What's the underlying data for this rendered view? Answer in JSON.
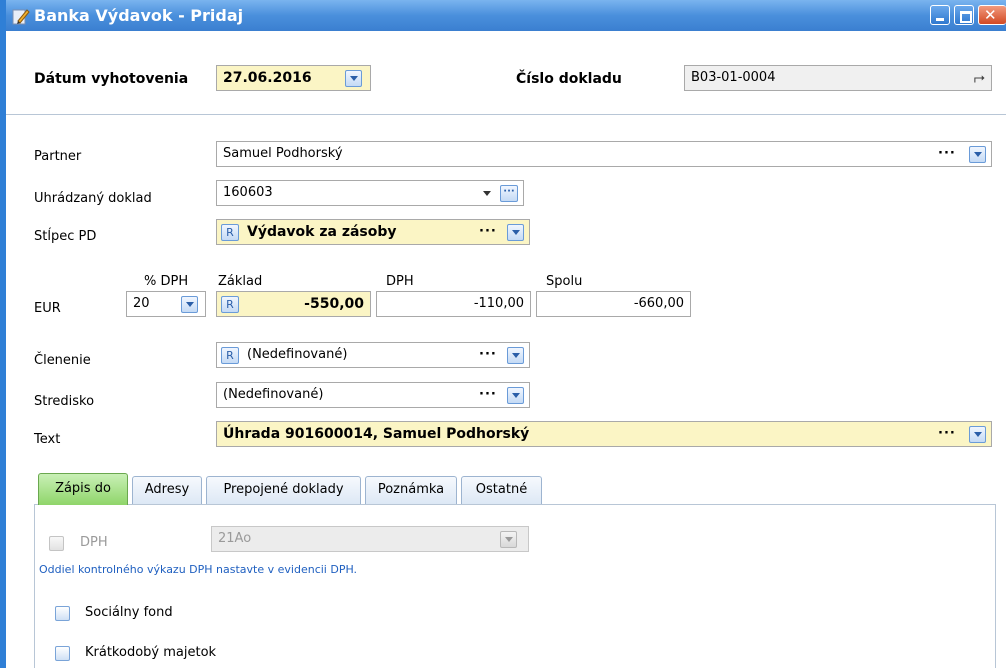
{
  "window": {
    "title": "Banka Výdavok - Pridaj"
  },
  "header": {
    "date_label": "Dátum vyhotovenia",
    "date_value": "27.06.2016",
    "doc_number_label": "Číslo dokladu",
    "doc_number_value": "B03-01-0004"
  },
  "form": {
    "partner_label": "Partner",
    "partner_value": "Samuel Podhorský",
    "paid_doc_label": "Uhrádzaný doklad",
    "paid_doc_value": "160603",
    "column_label": "Stĺpec PD",
    "column_value": "Výdavok za zásoby",
    "currency_label": "EUR",
    "vat_pct_header": "% DPH",
    "vat_pct_value": "20",
    "base_header": "Základ",
    "base_value": "-550,00",
    "vat_header": "DPH",
    "vat_value": "-110,00",
    "total_header": "Spolu",
    "total_value": "-660,00",
    "breakdown_label": "Členenie",
    "breakdown_value": "(Nedefinované)",
    "center_label": "Stredisko",
    "center_value": "(Nedefinované)",
    "text_label": "Text",
    "text_value": "Úhrada 901600014, Samuel Podhorský",
    "r_badge": "R",
    "dots": "···"
  },
  "tabs": [
    {
      "label": "Zápis do",
      "active": true
    },
    {
      "label": "Adresy",
      "active": false
    },
    {
      "label": "Prepojené doklady",
      "active": false
    },
    {
      "label": "Poznámka",
      "active": false
    },
    {
      "label": "Ostatné",
      "active": false
    }
  ],
  "panel": {
    "vat_check_label": "DPH",
    "vat_section_value": "21Ao",
    "vat_note": "Oddiel kontrolného výkazu DPH nastavte v evidencii DPH.",
    "social_fund_label": "Sociálny fond",
    "short_term_label": "Krátkodobý majetok"
  },
  "colors": {
    "titlebar": "#3b7fd0",
    "required_field": "#fbf5c5",
    "active_tab": "#8fd56a",
    "note_text": "#2060c0"
  }
}
